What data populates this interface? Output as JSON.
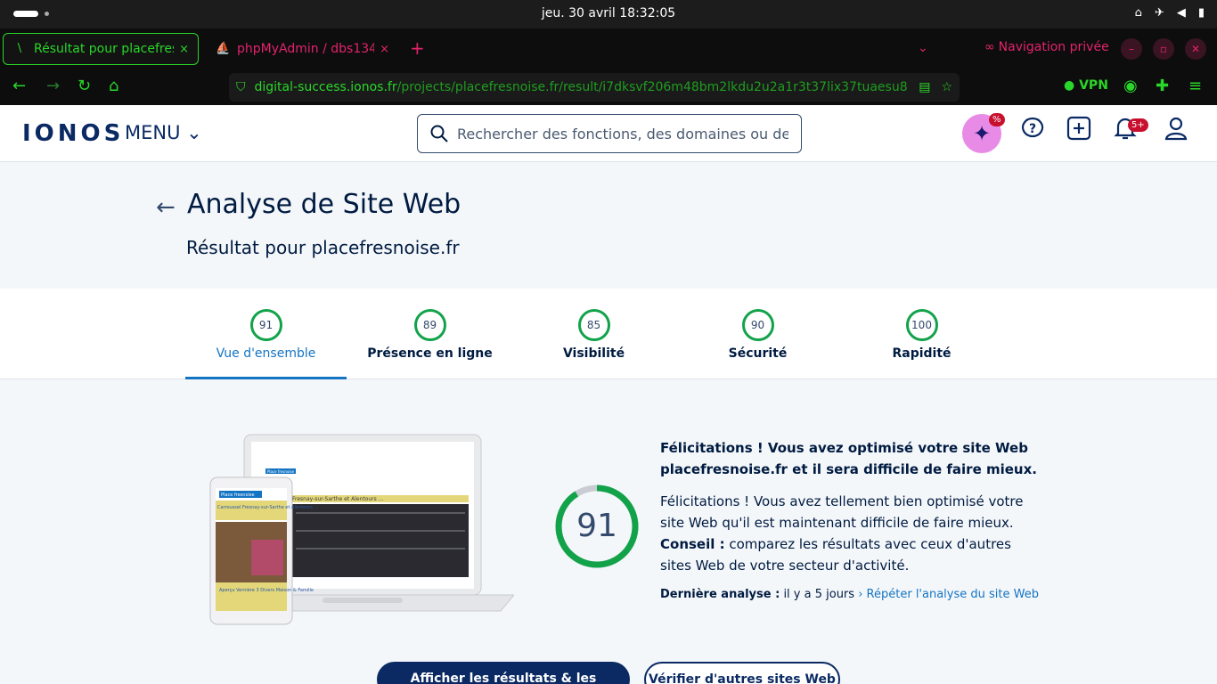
{
  "os": {
    "clock": "jeu. 30 avril  18:32:05"
  },
  "browser": {
    "tabs": [
      {
        "title": "Résultat pour placefresnoise.fr",
        "close": "×"
      },
      {
        "title": "phpMyAdmin / dbs13401",
        "close": "×"
      }
    ],
    "new_tab": "+",
    "private_label": "Navigation privée",
    "url_domain": "digital-success.ionos.fr",
    "url_path": "/projects/placefresnoise.fr/result/i7dksvf206m48bm2lkdu2u2a1r3t37lix37tuaesu8",
    "vpn_label": "VPN"
  },
  "header": {
    "logo": "IONOS",
    "menu_label": "MENU",
    "search_placeholder": "Rechercher des fonctions, des domaines ou de l’...",
    "ai_badge": "%",
    "notif_badge": "5+"
  },
  "page": {
    "title": "Analyse de Site Web",
    "subtitle": "Résultat pour placefresnoise.fr"
  },
  "score_tabs": [
    {
      "score": "91",
      "label": "Vue d'ensemble"
    },
    {
      "score": "89",
      "label": "Présence en ligne"
    },
    {
      "score": "85",
      "label": "Visibilité"
    },
    {
      "score": "90",
      "label": "Sécurité"
    },
    {
      "score": "100",
      "label": "Rapidité"
    }
  ],
  "result": {
    "score": "91",
    "score_fraction": 0.91,
    "headline": "Félicitations ! Vous avez optimisé votre site Web placefresnoise.fr et il sera difficile de faire mieux.",
    "body": "Félicitations ! Vous avez tellement bien optimisé votre site Web qu'il est maintenant difficile de faire mieux.",
    "tip_label": "Conseil :",
    "tip": " comparez les résultats avec ceux d'autres sites Web de votre secteur d'activité.",
    "last_label": "Dernière analyse :",
    "last_value": " il y a 5 jours",
    "rerun_link": "Répéter l'analyse du site Web"
  },
  "preview": {
    "site_badge": "Place fresnoise",
    "banner": "Fresnay-sur-Sarthe et Alentours ...",
    "mobile_caption": "Carroussel Fresnay-sur-Sarthe et Alentours ...",
    "mobile_footer": "Aperçu Vernière 3 Divers Maison & Famille"
  },
  "actions": {
    "primary": "Afficher les résultats & les solutions",
    "secondary": "Vérifier d'autres sites Web"
  },
  "colors": {
    "accent": "#1474c4",
    "brand": "#0b2a63",
    "score_green": "#12a34a",
    "browser_green": "#29d629",
    "private_pink": "#e3236b"
  }
}
